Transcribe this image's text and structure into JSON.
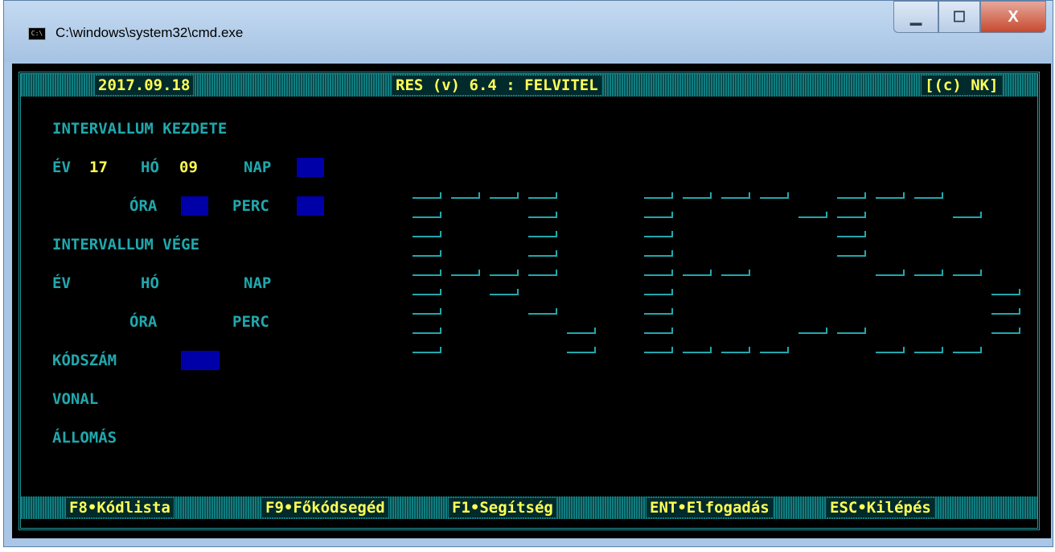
{
  "window": {
    "title": "C:\\windows\\system32\\cmd.exe",
    "icon_text": "C:\\",
    "minimize_label": "▁",
    "maximize_label": "☐",
    "close_label": "X"
  },
  "header": {
    "date": "2017.09.18",
    "app_title": "RES (v) 6.4 : FELVITEL",
    "copyright": "[(c) NK]"
  },
  "form": {
    "start_heading": "INTERVALLUM KEZDETE",
    "ev_label": "ÉV",
    "ev_value": "17",
    "ho_label": "HÓ",
    "ho_value": "09",
    "nap_label": "NAP",
    "ora_label": "ÓRA",
    "perc_label": "PERC",
    "end_heading": "INTERVALLUM VÉGE",
    "end_ev_label": "ÉV",
    "end_ho_label": "HÓ",
    "end_nap_label": "NAP",
    "end_ora_label": "ÓRA",
    "end_perc_label": "PERC",
    "kodszam_label": "KÓDSZÁM",
    "vonal_label": "VONAL",
    "allomas_label": "ÁLLOMÁS"
  },
  "logo_text": "RES",
  "footer": {
    "keys": [
      {
        "label": "F8•Kódlista"
      },
      {
        "label": "F9•Főkódsegéd"
      },
      {
        "label": "F1•Segítség"
      },
      {
        "label": "ENT•Elfogadás"
      },
      {
        "label": "ESC•Kilépés"
      }
    ]
  },
  "colors": {
    "console_bg": "#000000",
    "label": "#20a8ad",
    "value": "#ffff55",
    "field": "#0000a8"
  }
}
